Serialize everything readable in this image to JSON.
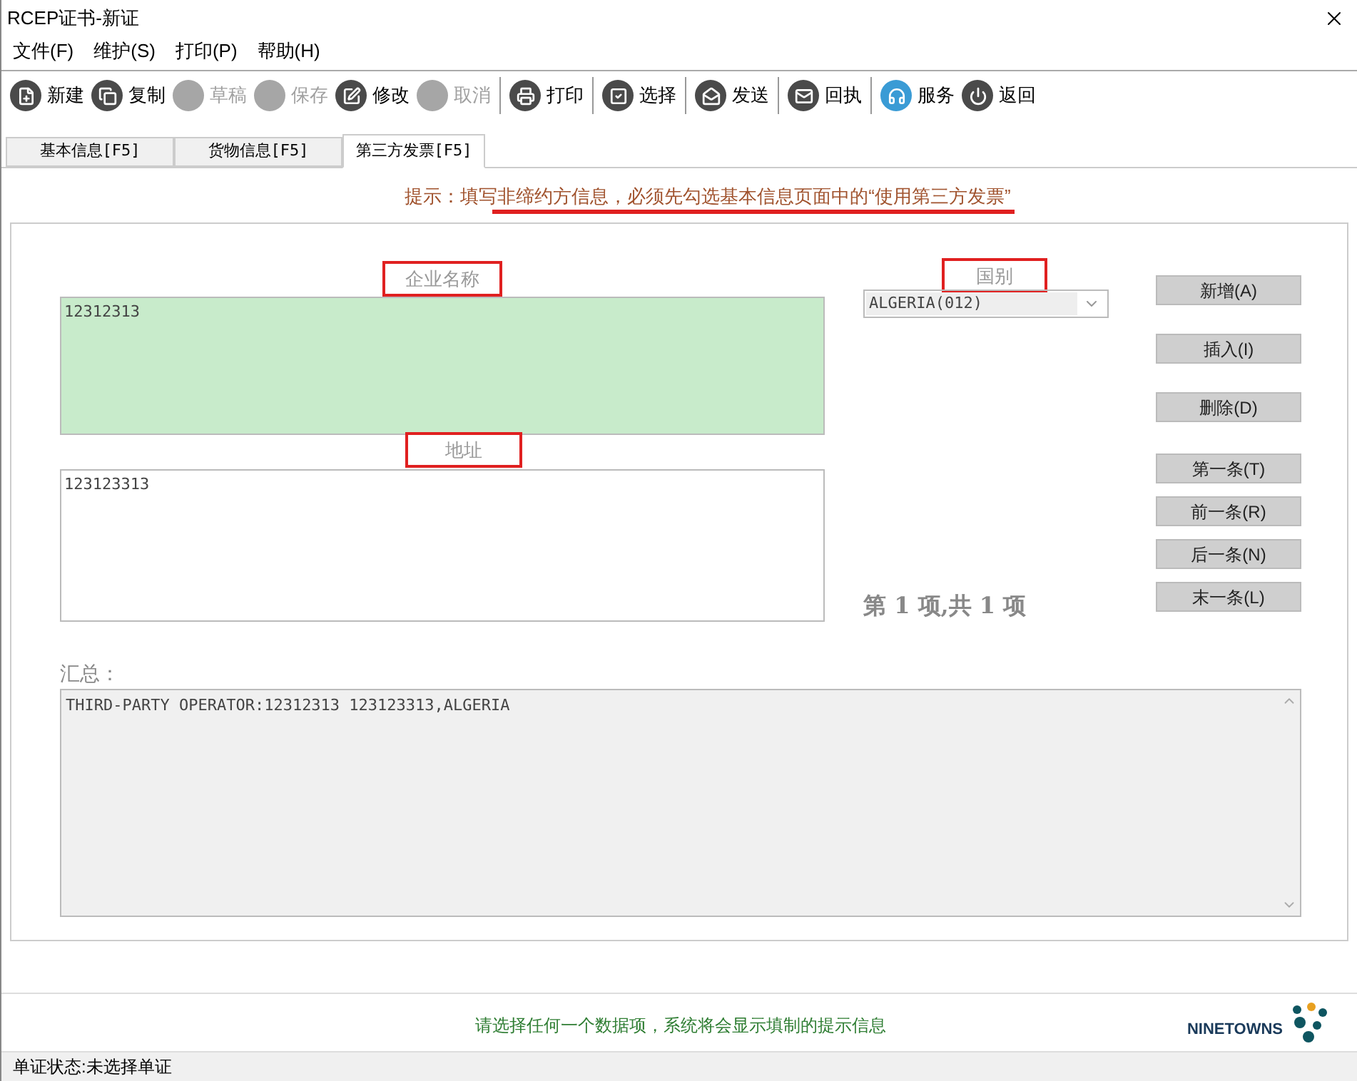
{
  "window": {
    "title": "RCEP证书-新证"
  },
  "menu": [
    {
      "label": "文件(F)"
    },
    {
      "label": "维护(S)"
    },
    {
      "label": "打印(P)"
    },
    {
      "label": "帮助(H)"
    }
  ],
  "toolbar": [
    {
      "label": "新建",
      "kind": "new",
      "disabled": false
    },
    {
      "label": "复制",
      "kind": "copy",
      "disabled": false
    },
    {
      "label": "草稿",
      "kind": "draft",
      "disabled": true
    },
    {
      "label": "保存",
      "kind": "save",
      "disabled": true
    },
    {
      "label": "修改",
      "kind": "edit",
      "disabled": false
    },
    {
      "label": "取消",
      "kind": "cancel",
      "disabled": true
    },
    {
      "kind": "separator"
    },
    {
      "label": "打印",
      "kind": "print",
      "disabled": false
    },
    {
      "kind": "separator"
    },
    {
      "label": "选择",
      "kind": "select",
      "disabled": false
    },
    {
      "kind": "separator"
    },
    {
      "label": "发送",
      "kind": "send",
      "disabled": false
    },
    {
      "kind": "separator"
    },
    {
      "label": "回执",
      "kind": "receipt",
      "disabled": false
    },
    {
      "kind": "separator"
    },
    {
      "label": "服务",
      "kind": "service",
      "disabled": false
    },
    {
      "label": "返回",
      "kind": "back",
      "disabled": false
    }
  ],
  "tabs": [
    {
      "label": "基本信息[F5]",
      "selected": false
    },
    {
      "label": "货物信息[F5]",
      "selected": false
    },
    {
      "label": "第三方发票[F5]",
      "selected": true
    }
  ],
  "hint": "提示：填写非缔约方信息，必须先勾选基本信息页面中的“使用第三方发票”",
  "form": {
    "company_label": "企业名称",
    "company_value": "12312313",
    "address_label": "地址",
    "address_value": "123123313",
    "country_label": "国别",
    "country_value": "ALGERIA(012)"
  },
  "buttons": [
    {
      "label": "新增(A)"
    },
    {
      "label": "插入(I)"
    },
    {
      "label": "删除(D)"
    },
    {
      "label": "第一条(T)"
    },
    {
      "label": "前一条(R)"
    },
    {
      "label": "后一条(N)"
    },
    {
      "label": "末一条(L)"
    }
  ],
  "record_counter": "第 1 项,共 1 项",
  "summary": {
    "label": "汇总：",
    "value": "THIRD-PARTY OPERATOR:12312313 123123313,ALGERIA"
  },
  "footer_hint": "请选择任何一个数据项，系统将会显示填制的提示信息",
  "logo": "NINETOWNS",
  "status_bar": "单证状态:未选择单证"
}
